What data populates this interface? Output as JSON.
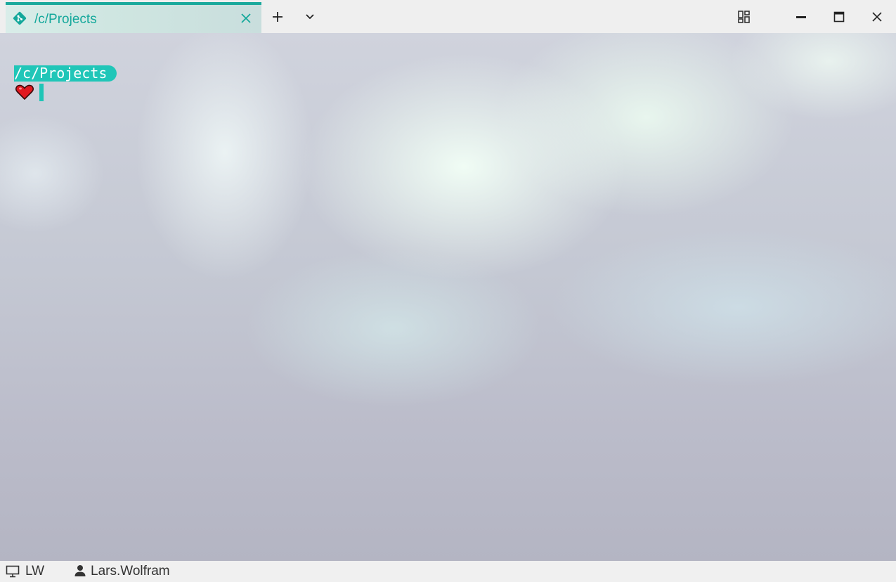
{
  "window": {
    "tab": {
      "title": "/c/Projects",
      "icon": "git-icon"
    },
    "accent_color": "#1aa99c",
    "controls": [
      "new-tab",
      "tab-dropdown",
      "layout",
      "minimize",
      "maximize",
      "close"
    ]
  },
  "terminal": {
    "prompt_path": "/c/Projects",
    "prompt_symbol_icon": "heart-icon",
    "prompt_bg_color": "#20c6b8"
  },
  "statusbar": {
    "host": "LW",
    "user": "Lars.Wolfram"
  }
}
